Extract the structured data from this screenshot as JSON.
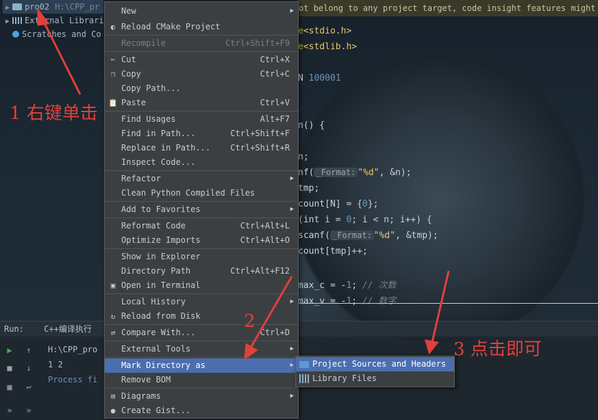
{
  "warning_bar": "ot belong to any project target, code insight features might no",
  "tree": {
    "project_name": "pro02",
    "project_path": "H:\\CPP_pr",
    "external_libraries": "External Librari",
    "scratches": "Scratches and Co"
  },
  "code_lines": [
    {
      "text_a": "e",
      "text_b": "<stdio.h>"
    },
    {
      "text_a": "e",
      "text_b": "<stdlib.h>"
    },
    {
      "text_a": "N ",
      "text_b": "100001"
    },
    {
      "text_a": "n() {"
    },
    {
      "text_a": "n;"
    },
    {
      "text_a": "nf(",
      "hint": "_Format:",
      "str": "\"%d\"",
      "rest": ", &n);"
    },
    {
      "text_a": "tmp;"
    },
    {
      "text_a": "count[N] = {",
      "num": "0",
      "rest": "};"
    },
    {
      "text_a": "(int i = ",
      "num": "0",
      "rest": "; i < n; i++) {"
    },
    {
      "text_a": "scanf(",
      "hint": "_Format:",
      "str": "\"%d\"",
      "rest": ", &tmp);"
    },
    {
      "text_a": "count[tmp]++;"
    },
    {
      "text_a": "max_c = -",
      "num": "1",
      "rest": "; ",
      "comment": "// 次数"
    },
    {
      "text_a": "max_v = -",
      "num": "1",
      "rest": "; ",
      "comment": "// 数字"
    }
  ],
  "run_panel": {
    "label": "Run:",
    "tab": "C++编译执行",
    "output_path": "H:\\CPP_pro",
    "output_line": "1 2",
    "process_line": "Process fi"
  },
  "context_menu": {
    "items": [
      {
        "label": "New",
        "submenu": true
      },
      {
        "label": "Reload CMake Project",
        "icon": "cmake-icon"
      },
      {
        "label": "Recompile",
        "shortcut": "Ctrl+Shift+F9",
        "disabled": true
      },
      {
        "label": "Cut",
        "shortcut": "Ctrl+X",
        "icon": "scissors-icon"
      },
      {
        "label": "Copy",
        "shortcut": "Ctrl+C",
        "icon": "copy-icon"
      },
      {
        "label": "Copy Path...",
        "shortcut": ""
      },
      {
        "label": "Paste",
        "shortcut": "Ctrl+V",
        "icon": "paste-icon"
      },
      {
        "label": "Find Usages",
        "shortcut": "Alt+F7"
      },
      {
        "label": "Find in Path...",
        "shortcut": "Ctrl+Shift+F"
      },
      {
        "label": "Replace in Path...",
        "shortcut": "Ctrl+Shift+R"
      },
      {
        "label": "Inspect Code..."
      },
      {
        "label": "Refactor",
        "submenu": true
      },
      {
        "label": "Clean Python Compiled Files"
      },
      {
        "label": "Add to Favorites",
        "submenu": true
      },
      {
        "label": "Reformat Code",
        "shortcut": "Ctrl+Alt+L"
      },
      {
        "label": "Optimize Imports",
        "shortcut": "Ctrl+Alt+O"
      },
      {
        "label": "Show in Explorer"
      },
      {
        "label": "Directory Path",
        "shortcut": "Ctrl+Alt+F12"
      },
      {
        "label": "Open in Terminal",
        "icon": "terminal-icon"
      },
      {
        "label": "Local History",
        "submenu": true
      },
      {
        "label": "Reload from Disk",
        "icon": "reload-icon"
      },
      {
        "label": "Compare With...",
        "shortcut": "Ctrl+D",
        "icon": "compare-icon"
      },
      {
        "label": "External Tools",
        "submenu": true
      },
      {
        "label": "Mark Directory as",
        "submenu": true,
        "active": true
      },
      {
        "label": "Remove BOM"
      },
      {
        "label": "Diagrams",
        "submenu": true,
        "icon": "diagram-icon"
      },
      {
        "label": "Create Gist...",
        "icon": "github-icon"
      }
    ]
  },
  "submenu": {
    "items": [
      {
        "label": "Project Sources and Headers",
        "active": true,
        "icon": "folder-icon"
      },
      {
        "label": "Library Files",
        "icon": "library-icon"
      }
    ]
  },
  "annotations": {
    "step1": "1 右键单击",
    "step2": "2",
    "step3": "3 点击即可"
  },
  "colors": {
    "menu_bg": "#3c3f41",
    "highlight": "#4b6eaf",
    "annotation": "#e0413a"
  }
}
